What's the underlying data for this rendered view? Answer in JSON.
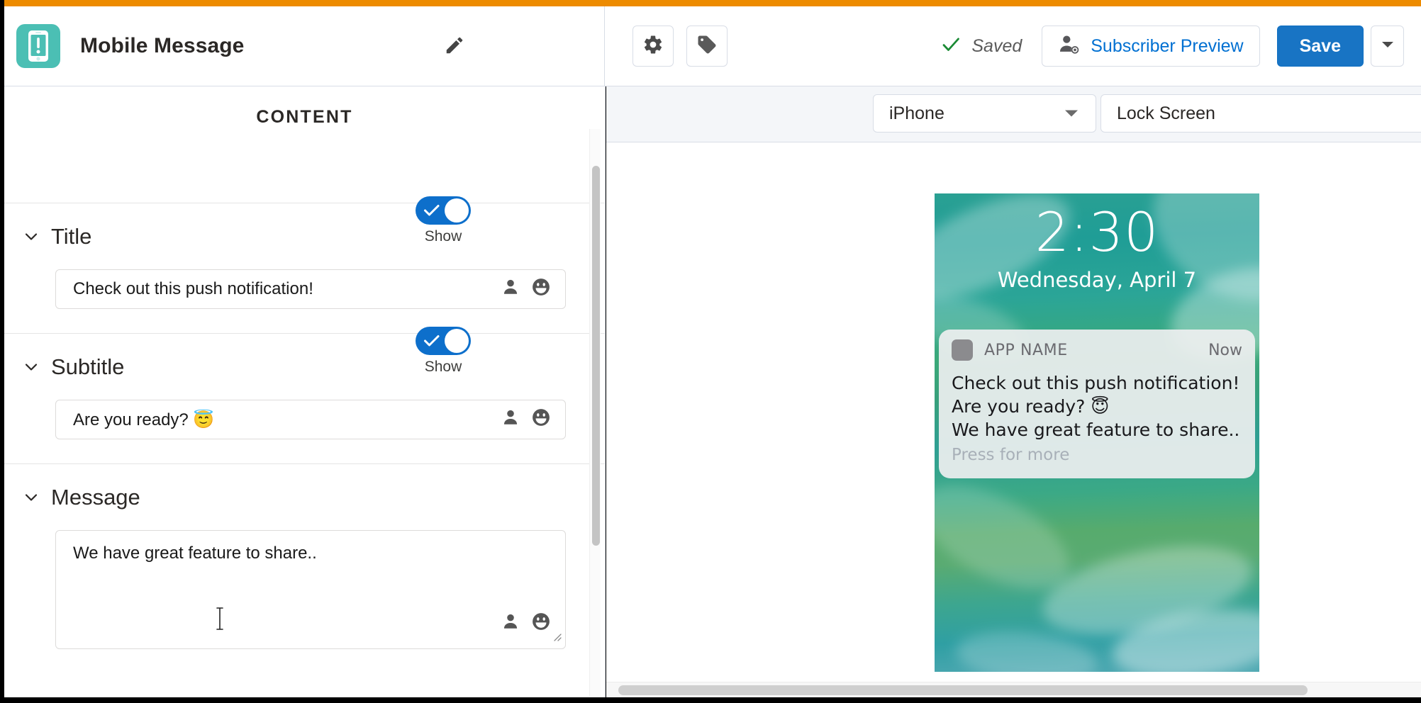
{
  "window": {
    "accent_orange": "#ED8B00",
    "brand_blue": "#0070d2",
    "teal": "#4bbfb4"
  },
  "header": {
    "app_title": "Mobile Message",
    "app_icon_name": "mobile-message-icon",
    "edit_icon_name": "pencil-icon",
    "settings_icon_name": "gear-icon",
    "tag_icon_name": "tag-icon",
    "saved_status": "Saved",
    "saved_check_icon": "check-icon",
    "subscriber_preview_label": "Subscriber Preview",
    "subscriber_preview_icon": "user-preview-icon",
    "save_label": "Save",
    "save_menu_icon": "chevron-down-icon"
  },
  "content_panel": {
    "heading": "CONTENT",
    "sections": [
      {
        "title": "Title",
        "toggle_label": "Show",
        "toggle_on": true,
        "value": "Check out this push notification!",
        "type": "input"
      },
      {
        "title": "Subtitle",
        "toggle_label": "Show",
        "toggle_on": true,
        "value": "Are you ready? 😇",
        "type": "input"
      },
      {
        "title": "Message",
        "toggle_label": "",
        "toggle_on": false,
        "value": "We have great feature to share..",
        "type": "textarea"
      }
    ],
    "field_icons": [
      "personalization-icon",
      "emoji-icon"
    ]
  },
  "preview_panel": {
    "device_select": "iPhone",
    "screen_select": "Lock Screen",
    "device_caret_icon": "caret-down-icon",
    "lock_screen": {
      "time": "2:30",
      "date": "Wednesday, April 7"
    },
    "notification": {
      "app_name": "APP NAME",
      "timestamp": "Now",
      "title": "Check out this push notification!",
      "subtitle": "Are you ready? 😇",
      "message": "We have great feature to share..",
      "press_for_more": "Press for more"
    }
  }
}
